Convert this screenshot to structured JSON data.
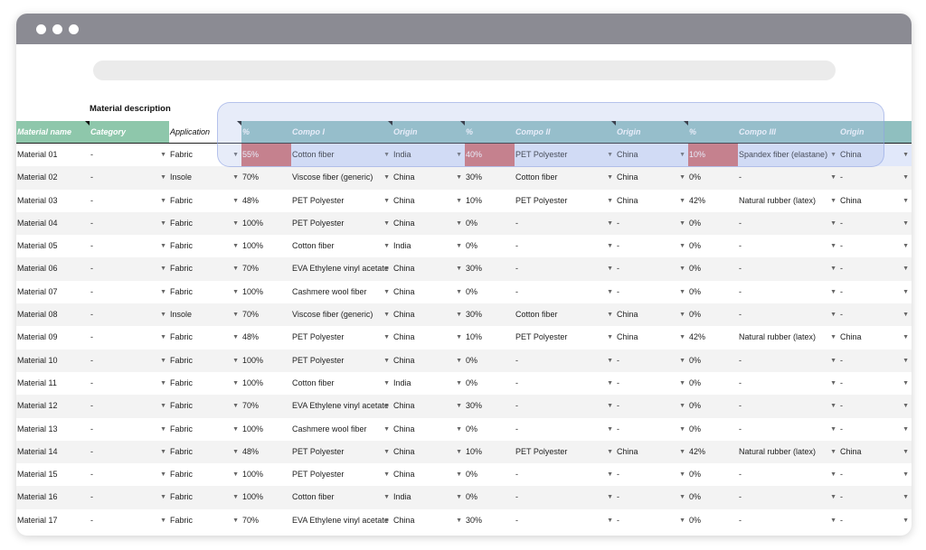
{
  "section_label": "Material description",
  "columns": [
    "Material name",
    "Category",
    "Application",
    "%",
    "Compo I",
    "Origin",
    "%",
    "Compo II",
    "Origin",
    "%",
    "Compo III",
    "Origin"
  ],
  "rows": [
    [
      "Material 01",
      "-",
      "Fabric",
      "55%",
      "Cotton fiber",
      "India",
      "40%",
      "PET Polyester",
      "China",
      "10%",
      "Spandex fiber (elastane)",
      "China"
    ],
    [
      "Material 02",
      "-",
      "Insole",
      "70%",
      "Viscose fiber (generic)",
      "China",
      "30%",
      "Cotton fiber",
      "China",
      "0%",
      "-",
      "-"
    ],
    [
      "Material 03",
      "-",
      "Fabric",
      "48%",
      "PET Polyester",
      "China",
      "10%",
      "PET Polyester",
      "China",
      "42%",
      "Natural rubber (latex)",
      "China"
    ],
    [
      "Material 04",
      "-",
      "Fabric",
      "100%",
      "PET Polyester",
      "China",
      "0%",
      "-",
      "-",
      "0%",
      "-",
      "-"
    ],
    [
      "Material 05",
      "-",
      "Fabric",
      "100%",
      "Cotton fiber",
      "India",
      "0%",
      "-",
      "-",
      "0%",
      "-",
      "-"
    ],
    [
      "Material 06",
      "-",
      "Fabric",
      "70%",
      "EVA Ethylene vinyl acetate",
      "China",
      "30%",
      "-",
      "-",
      "0%",
      "-",
      "-"
    ],
    [
      "Material 07",
      "-",
      "Fabric",
      "100%",
      "Cashmere wool fiber",
      "China",
      "0%",
      "-",
      "-",
      "0%",
      "-",
      "-"
    ],
    [
      "Material 08",
      "-",
      "Insole",
      "70%",
      "Viscose fiber (generic)",
      "China",
      "30%",
      "Cotton fiber",
      "China",
      "0%",
      "-",
      "-"
    ],
    [
      "Material 09",
      "-",
      "Fabric",
      "48%",
      "PET Polyester",
      "China",
      "10%",
      "PET Polyester",
      "China",
      "42%",
      "Natural rubber (latex)",
      "China"
    ],
    [
      "Material 10",
      "-",
      "Fabric",
      "100%",
      "PET Polyester",
      "China",
      "0%",
      "-",
      "-",
      "0%",
      "-",
      "-"
    ],
    [
      "Material 11",
      "-",
      "Fabric",
      "100%",
      "Cotton fiber",
      "India",
      "0%",
      "-",
      "-",
      "0%",
      "-",
      "-"
    ],
    [
      "Material 12",
      "-",
      "Fabric",
      "70%",
      "EVA Ethylene vinyl acetate",
      "China",
      "30%",
      "-",
      "-",
      "0%",
      "-",
      "-"
    ],
    [
      "Material 13",
      "-",
      "Fabric",
      "100%",
      "Cashmere wool fiber",
      "China",
      "0%",
      "-",
      "-",
      "0%",
      "-",
      "-"
    ],
    [
      "Material 14",
      "-",
      "Fabric",
      "48%",
      "PET Polyester",
      "China",
      "10%",
      "PET Polyester",
      "China",
      "42%",
      "Natural rubber (latex)",
      "China"
    ],
    [
      "Material 15",
      "-",
      "Fabric",
      "100%",
      "PET Polyester",
      "China",
      "0%",
      "-",
      "-",
      "0%",
      "-",
      "-"
    ],
    [
      "Material 16",
      "-",
      "Fabric",
      "100%",
      "Cotton fiber",
      "India",
      "0%",
      "-",
      "-",
      "0%",
      "-",
      "-"
    ],
    [
      "Material 17",
      "-",
      "Fabric",
      "70%",
      "EVA Ethylene vinyl acetate",
      "China",
      "30%",
      "-",
      "-",
      "0%",
      "-",
      "-"
    ]
  ],
  "colors": {
    "header_teal": "#8fbfbf",
    "header_green": "#8ec7ab",
    "alert_red": "#d06b6b",
    "selection_blue": "#e1e8fa"
  }
}
